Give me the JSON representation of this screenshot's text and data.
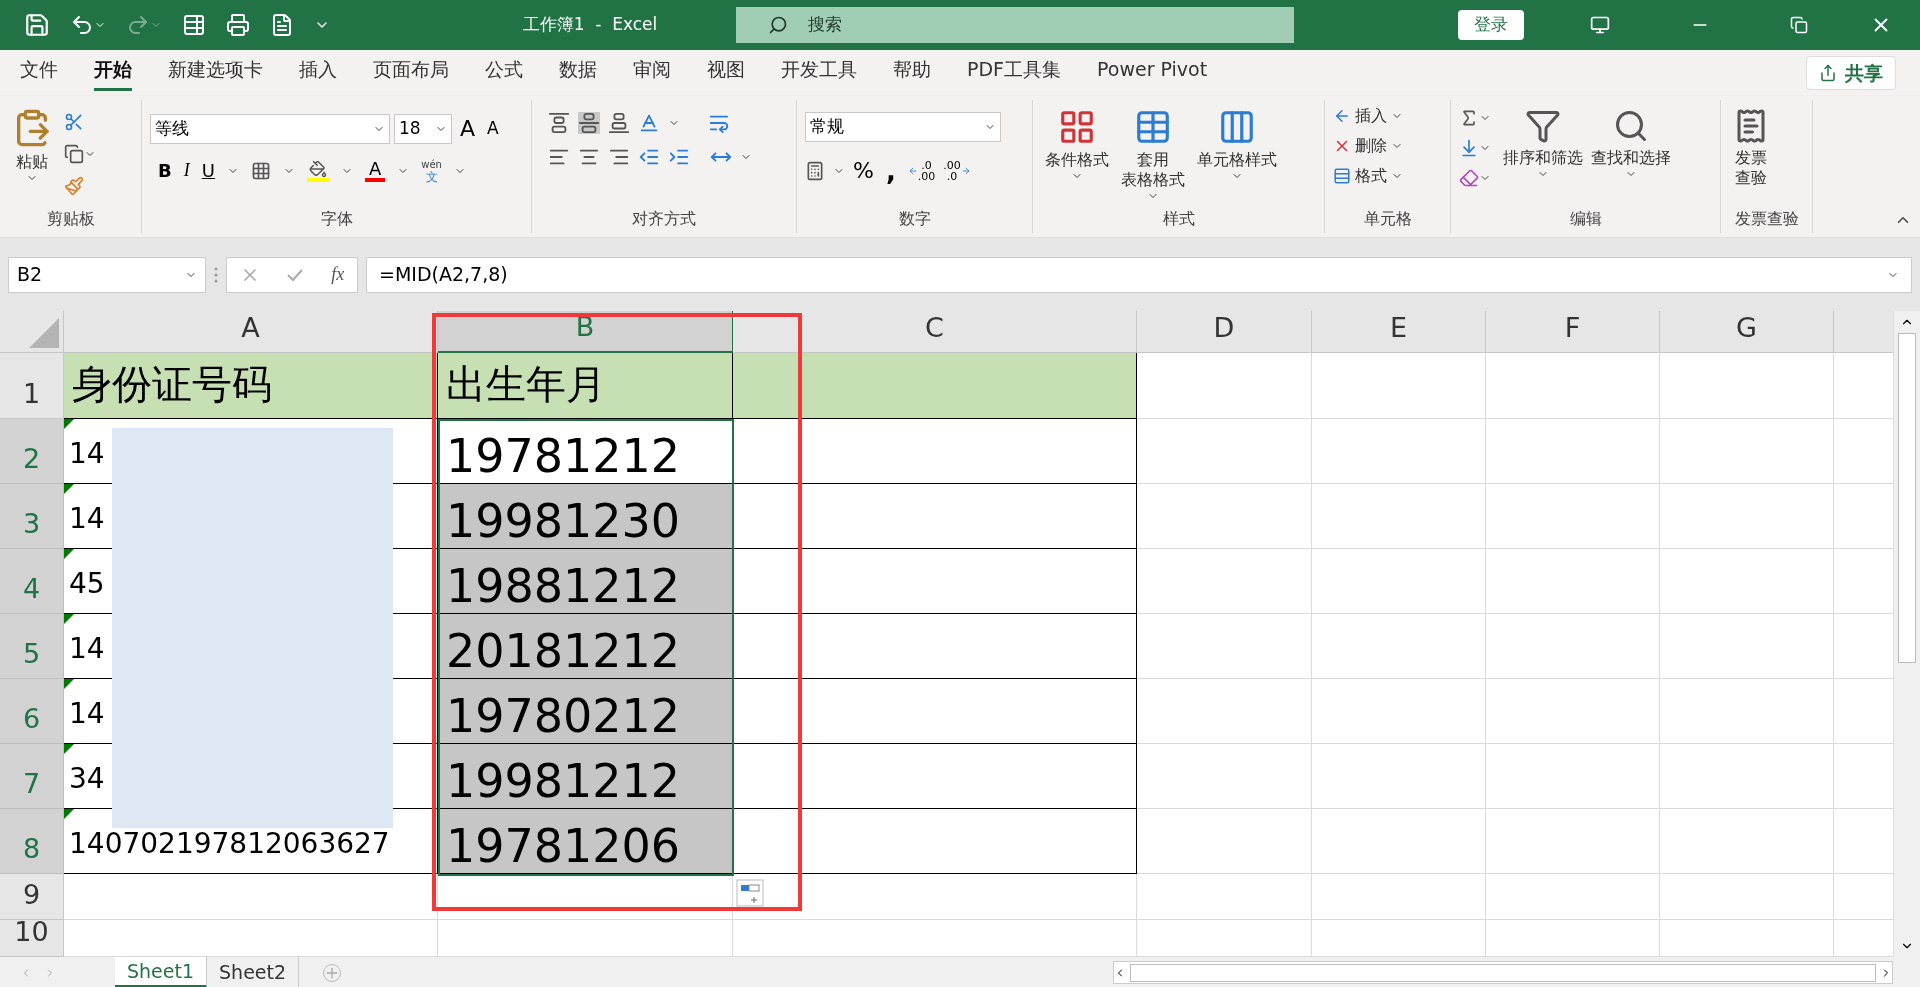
{
  "title_bar": {
    "title": "工作簿1  -  Excel",
    "search": {
      "placeholder": "搜索"
    },
    "login": "登录"
  },
  "tabs": [
    {
      "label": "文件",
      "selected": false
    },
    {
      "label": "开始",
      "selected": true
    },
    {
      "label": "新建选项卡",
      "selected": false
    },
    {
      "label": "插入",
      "selected": false
    },
    {
      "label": "页面布局",
      "selected": false
    },
    {
      "label": "公式",
      "selected": false
    },
    {
      "label": "数据",
      "selected": false
    },
    {
      "label": "审阅",
      "selected": false
    },
    {
      "label": "视图",
      "selected": false
    },
    {
      "label": "开发工具",
      "selected": false
    },
    {
      "label": "帮助",
      "selected": false
    },
    {
      "label": "PDF工具集",
      "selected": false
    },
    {
      "label": "Power Pivot",
      "selected": false
    }
  ],
  "share": "共享",
  "ribbon": {
    "clipboard": {
      "paste": "粘贴",
      "group": "剪贴板"
    },
    "font": {
      "name": "等线",
      "size": "18",
      "grow": "A",
      "shrink": "A",
      "bold": "B",
      "italic": "I",
      "underline": "U",
      "color_letter": "A",
      "phonetic_top": "wén",
      "phonetic_bottom": "文",
      "group": "字体"
    },
    "alignment": {
      "group": "对齐方式"
    },
    "number": {
      "format": "常规",
      "percent": "%",
      "comma": ",",
      "increase_decimal": [
        ".0",
        ".00"
      ],
      "decrease_decimal": [
        ".00",
        ".0"
      ],
      "group": "数字"
    },
    "styles": {
      "items": [
        {
          "line1": "条件格式"
        },
        {
          "line1": "套用",
          "line2": "表格格式"
        },
        {
          "line1": "单元格样式"
        }
      ],
      "group": "样式"
    },
    "cells": {
      "items": [
        "插入",
        "删除",
        "格式"
      ],
      "group": "单元格"
    },
    "editing": {
      "items": [
        "排序和筛选",
        "查找和选择"
      ],
      "group": "编辑"
    },
    "invoice": {
      "line1": "发票",
      "line2": "查验",
      "group": "发票查验"
    }
  },
  "formula_bar": {
    "name_box": "B2",
    "fx": "fx",
    "formula": "=MID(A2,7,8)"
  },
  "columns": [
    {
      "label": "A",
      "selected": false
    },
    {
      "label": "B",
      "selected": true
    },
    {
      "label": "C",
      "selected": false
    },
    {
      "label": "D",
      "selected": false
    },
    {
      "label": "E",
      "selected": false
    },
    {
      "label": "F",
      "selected": false
    },
    {
      "label": "G",
      "selected": false
    }
  ],
  "rows": [
    {
      "number": "1",
      "kind": "header",
      "selected": false,
      "a": "身份证号码",
      "b": "出生年月"
    },
    {
      "number": "2",
      "kind": "data",
      "selected": true,
      "a": "14",
      "b": "19781212",
      "b_highlighted": false
    },
    {
      "number": "3",
      "kind": "data",
      "selected": true,
      "a": "14",
      "b": "19981230",
      "b_highlighted": true
    },
    {
      "number": "4",
      "kind": "data",
      "selected": true,
      "a": "45",
      "b": "19881212",
      "b_highlighted": true
    },
    {
      "number": "5",
      "kind": "data",
      "selected": true,
      "a": "14",
      "b": "20181212",
      "b_highlighted": true
    },
    {
      "number": "6",
      "kind": "data",
      "selected": true,
      "a": "14",
      "b": "19780212",
      "b_highlighted": true
    },
    {
      "number": "7",
      "kind": "data",
      "selected": true,
      "a": "34",
      "b": "19981212",
      "b_highlighted": true
    },
    {
      "number": "8",
      "kind": "data",
      "selected": true,
      "a": "140702197812063627",
      "b": "19781206",
      "b_highlighted": true
    },
    {
      "number": "9",
      "kind": "empty",
      "selected": false
    },
    {
      "number": "10",
      "kind": "empty",
      "selected": false
    }
  ],
  "sheets": [
    {
      "label": "Sheet1",
      "selected": true
    },
    {
      "label": "Sheet2",
      "selected": false
    }
  ]
}
